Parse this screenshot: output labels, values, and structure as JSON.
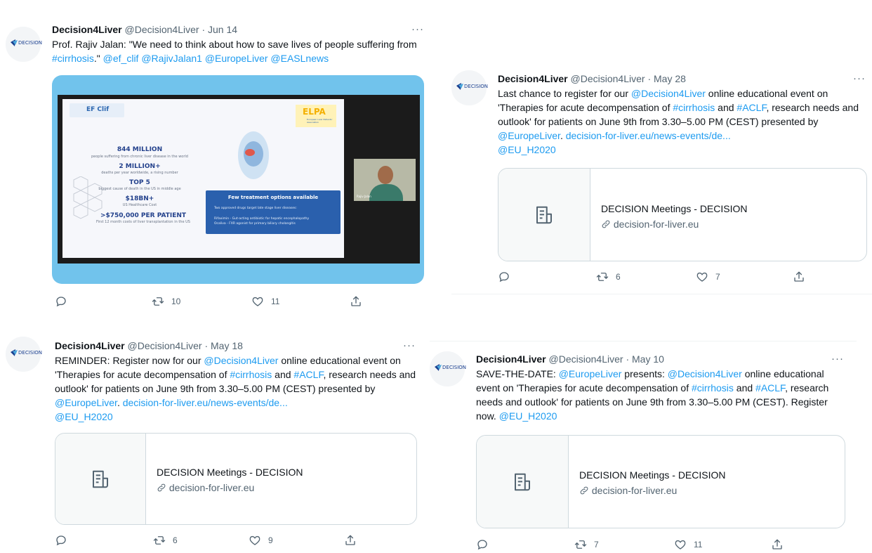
{
  "tweets": [
    {
      "name": "Decision4Liver",
      "handle": "@Decision4Liver",
      "date": "Jun 14",
      "more": "···",
      "text_prefix": "Prof. Rajiv Jalan: \"We need to think about how to save lives of people suffering from ",
      "tag_cirrhosis": "#cirrhosis",
      "text_mid": ".\" ",
      "mention1": "@ef_clif",
      "mention2": "@RajivJalan1",
      "mention3": "@EuropeLiver",
      "mention4": "@EASLnews",
      "media": {
        "logo_left": "EF Clif",
        "logo_right": "ELPA",
        "logo_right_sub": "European Liver Patients' Association",
        "stat1": "844 MILLION",
        "stat1_sub": "people suffering from chronic liver disease in the world",
        "stat2": "2 MILLION+",
        "stat2_sub": "deaths per year worldwide, a rising number",
        "stat3": "TOP 5",
        "stat3_sub": "biggest cause of death in the US in middle age",
        "stat4": "$18BN+",
        "stat4_sub": "US Healthcare Cost",
        "stat5": ">$750,000 PER PATIENT",
        "stat5_sub": "First 12 month costs of liver transplantation in the US",
        "box_title": "Few treatment options available",
        "box_line1": "Two approved drugs target late stage liver diseases:",
        "box_line2": "Rifaximin - Gut-acting antibiotic for hepatic encephalopathy",
        "box_line3": "Ocaliva - FXR agonist for primary biliary cholangitis",
        "speaker": "Rajiv Jalan"
      },
      "retweets": "10",
      "likes": "11"
    },
    {
      "name": "Decision4Liver",
      "handle": "@Decision4Liver",
      "date": "May 28",
      "more": "···",
      "p1": "Last chance to register for our ",
      "m1": "@Decision4Liver",
      "p2": " online educational event on 'Therapies for acute decompensation of ",
      "h1": "#cirrhosis",
      "p3": " and ",
      "h2": "#ACLF",
      "p4": ", research needs and outlook' for patients on June 9th from 3.30–5.00 PM (CEST) presented by ",
      "m2": "@EuropeLiver",
      "p5": ". ",
      "url": "decision-for-liver.eu/news-events/de...",
      "m3": "@EU_H2020",
      "card_title": "DECISION Meetings - DECISION",
      "card_domain": "decision-for-liver.eu",
      "retweets": "6",
      "likes": "7"
    },
    {
      "name": "Decision4Liver",
      "handle": "@Decision4Liver",
      "date": "May 18",
      "more": "···",
      "p1": "REMINDER: Register now for our ",
      "m1": "@Decision4Liver",
      "p2": " online educational event on 'Therapies for acute decompensation of ",
      "h1": "#cirrhosis",
      "p3": " and ",
      "h2": "#ACLF",
      "p4": ", research needs and outlook' for patients on June 9th from 3.30–5.00 PM (CEST) presented by ",
      "m2": "@EuropeLiver",
      "p5": ". ",
      "url": "decision-for-liver.eu/news-events/de...",
      "m3": "@EU_H2020",
      "card_title": "DECISION Meetings - DECISION",
      "card_domain": "decision-for-liver.eu",
      "retweets": "6",
      "likes": "9"
    },
    {
      "name": "Decision4Liver",
      "handle": "@Decision4Liver",
      "date": "May 10",
      "more": "···",
      "p1": "SAVE-THE-DATE: ",
      "m1": "@EuropeLiver",
      "p2": " presents: ",
      "m2": "@Decision4Liver",
      "p3": " online educational event on 'Therapies for acute decompensation of ",
      "h1": "#cirrhosis",
      "p4": " and ",
      "h2": "#ACLF",
      "p5": ", research needs and outlook' for patients on June 9th from 3.30–5.00 PM (CEST). Register now. ",
      "m3": "@EU_H2020",
      "card_title": "DECISION Meetings - DECISION",
      "card_domain": "decision-for-liver.eu",
      "retweets": "7",
      "likes": "11"
    }
  ],
  "avatar_text": "DECISION",
  "dot": "·",
  "colors": {
    "link": "#1d9bf0",
    "muted": "#536471",
    "border": "#cfd9de",
    "media_bg": "#71c3ec"
  },
  "icons": [
    "reply-icon",
    "retweet-icon",
    "like-icon",
    "share-icon",
    "article-icon",
    "link-icon"
  ]
}
